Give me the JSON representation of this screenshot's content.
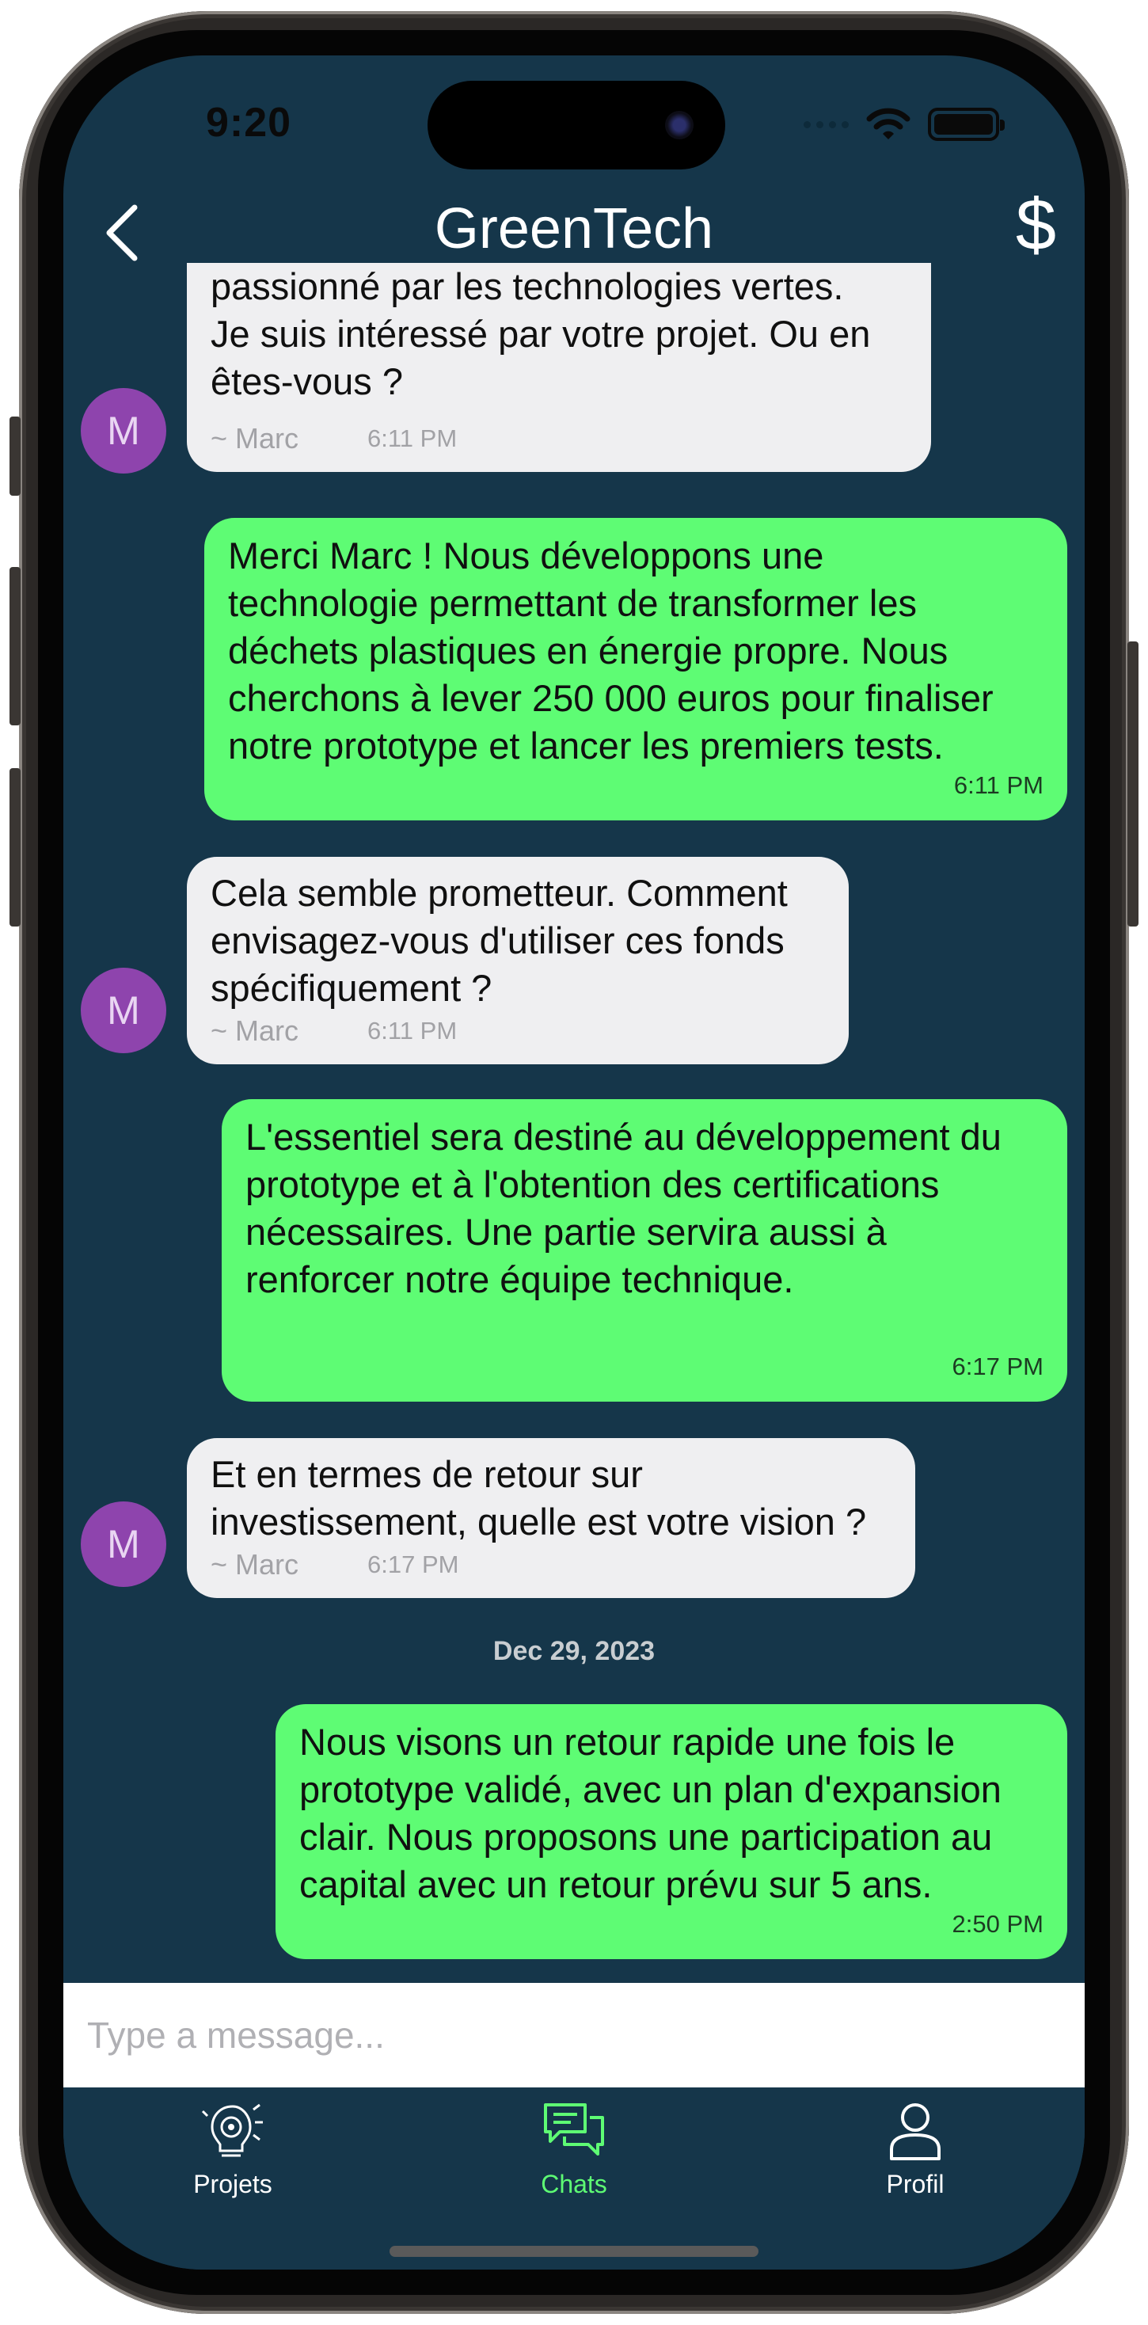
{
  "status_bar": {
    "time": "9:20"
  },
  "header": {
    "title": "GreenTech",
    "action_symbol": "$"
  },
  "messages": [
    {
      "direction": "in",
      "text": "Salut Alex, je suis Marc investisseur\npassionné par les technologies vertes.\nJe suis intéressé par votre projet. Ou en\nêtes-vous ?",
      "sender": "~ Marc",
      "time": "6:11 PM",
      "avatar": "M"
    },
    {
      "direction": "out",
      "text": "Merci Marc ! Nous développons une\ntechnologie permettant de transformer les\ndéchets plastiques en énergie propre. Nous\ncherchons à lever 250 000 euros pour finaliser\nnotre prototype et lancer les premiers tests.",
      "time": "6:11 PM"
    },
    {
      "direction": "in",
      "text": "Cela semble prometteur. Comment\nenvisagez-vous d'utiliser ces fonds\nspécifiquement ?",
      "sender": "~ Marc",
      "time": "6:11 PM",
      "avatar": "M"
    },
    {
      "direction": "out",
      "text": "L'essentiel sera destiné au développement du\nprototype et à l'obtention des certifications\nnécessaires. Une partie servira aussi à\nrenforcer notre équipe technique.",
      "time": "6:17 PM"
    },
    {
      "direction": "in",
      "text": "Et en termes de retour sur\ninvestissement, quelle est votre vision ?",
      "sender": "~ Marc",
      "time": "6:17 PM",
      "avatar": "M"
    },
    {
      "direction": "out",
      "text": "Nous visons un retour rapide une fois le\nprototype validé, avec un plan d'expansion\nclair. Nous proposons une participation au\ncapital avec un retour prévu sur 5 ans.",
      "time": "2:50 PM"
    }
  ],
  "date_separator": "Dec 29, 2023",
  "composer": {
    "placeholder": "Type a message..."
  },
  "tabs": [
    {
      "label": "Projets",
      "icon": "lightbulb-gear-icon",
      "active": false
    },
    {
      "label": "Chats",
      "icon": "chat-bubbles-icon",
      "active": true
    },
    {
      "label": "Profil",
      "icon": "user-icon",
      "active": false
    }
  ],
  "colors": {
    "background": "#15364a",
    "incoming_bubble": "#efeff1",
    "outgoing_bubble": "#5efc74",
    "avatar": "#8e44ad",
    "active_tab": "#5efc74"
  }
}
